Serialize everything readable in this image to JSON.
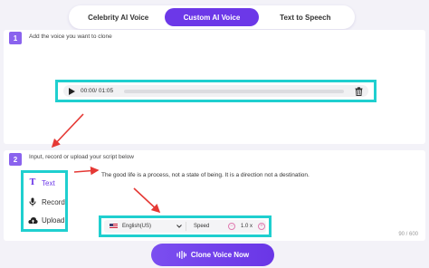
{
  "tabs": [
    {
      "label": "Celebrity AI Voice",
      "active": false
    },
    {
      "label": "Custom AI Voice",
      "active": true
    },
    {
      "label": "Text to Speech",
      "active": false
    }
  ],
  "step1": {
    "number": "1",
    "label": "Add the voice you want to clone"
  },
  "audio": {
    "time": "00:00/ 01:05",
    "progress": 0
  },
  "step2": {
    "number": "2",
    "label": "Input, record or upload your script below"
  },
  "modes": [
    {
      "label": "Text",
      "icon": "text-icon",
      "active": true
    },
    {
      "label": "Record",
      "icon": "microphone-icon",
      "active": false
    },
    {
      "label": "Upload",
      "icon": "upload-cloud-icon",
      "active": false
    }
  ],
  "script": {
    "text": "The good life is a process, not a state of being. It is a direction not a destination."
  },
  "settings": {
    "language": "English(US)",
    "speed_label": "Speed",
    "speed_value": "1.0 x",
    "decrease_symbol": "−",
    "increase_symbol": "+"
  },
  "counter": "90 / 600",
  "clone_button": {
    "label": "Clone Voice Now"
  },
  "colors": {
    "accent": "#6c38e8",
    "highlight": "#1fcfcf",
    "arrow": "#e53935",
    "badge": "#8a63ee"
  }
}
